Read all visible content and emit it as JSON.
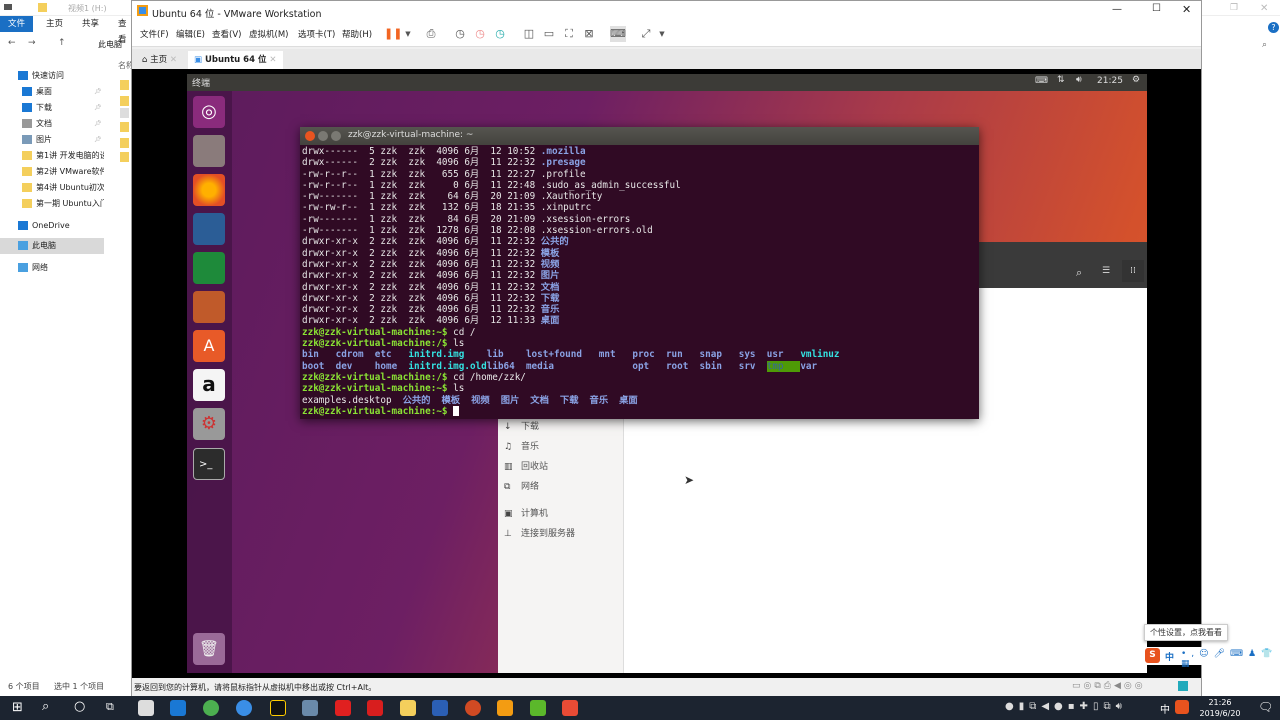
{
  "explorer": {
    "title": "视频1 (H:)",
    "ribbon_tabs": [
      "文件",
      "主页",
      "共享",
      "查看"
    ],
    "breadcrumb": "此电脑",
    "column_header": "名称",
    "sidebar": [
      {
        "label": "快速访问",
        "icon": "star-icon"
      },
      {
        "label": "桌面",
        "icon": "desktop-icon",
        "pinned": true
      },
      {
        "label": "下载",
        "icon": "download-icon",
        "pinned": true
      },
      {
        "label": "文档",
        "icon": "document-icon",
        "pinned": true
      },
      {
        "label": "图片",
        "icon": "picture-icon",
        "pinned": true
      },
      {
        "label": "第1讲 开发电脑的设",
        "icon": "folder-icon"
      },
      {
        "label": "第2讲 VMware软件",
        "icon": "folder-icon"
      },
      {
        "label": "第4讲 Ubuntu初次",
        "icon": "folder-icon"
      },
      {
        "label": "第一期 Ubuntu入门",
        "icon": "folder-icon"
      },
      {
        "label": "OneDrive",
        "icon": "cloud-icon"
      },
      {
        "label": "此电脑",
        "icon": "computer-icon",
        "selected": true
      },
      {
        "label": "网络",
        "icon": "network-icon"
      }
    ],
    "status_items": "6 个项目",
    "status_selected": "选中 1 个项目"
  },
  "vmware": {
    "title": "Ubuntu 64 位 - VMware Workstation",
    "menu": [
      "文件(F)",
      "编辑(E)",
      "查看(V)",
      "虚拟机(M)",
      "选项卡(T)",
      "帮助(H)"
    ],
    "tabs": [
      {
        "label": "主页",
        "active": false
      },
      {
        "label": "Ubuntu 64 位",
        "active": true
      }
    ],
    "status_text": "要返回到您的计算机，请将鼠标指针从虚拟机中移出或按 Ctrl+Alt。"
  },
  "ubuntu": {
    "top_title": "终端",
    "clock": "21:25",
    "launcher": [
      "ubuntu-dash-icon",
      "files-icon",
      "firefox-icon",
      "writer-icon",
      "calc-icon",
      "impress-icon",
      "software-center-icon",
      "amazon-icon",
      "settings-icon",
      "terminal-icon"
    ],
    "trash": "trash-icon",
    "nautilus_sidebar": [
      "下载",
      "音乐",
      "回收站",
      "网络",
      "计算机",
      "连接到服务器"
    ],
    "terminal": {
      "title": "zzk@zzk-virtual-machine: ~",
      "listing": [
        [
          "drwx------",
          "5",
          "zzk",
          "zzk",
          "4096",
          "6月",
          "12",
          "10:52",
          ".mozilla",
          "blue"
        ],
        [
          "drwx------",
          "2",
          "zzk",
          "zzk",
          "4096",
          "6月",
          "11",
          "22:32",
          ".presage",
          "blue"
        ],
        [
          "-rw-r--r--",
          "1",
          "zzk",
          "zzk",
          "655",
          "6月",
          "11",
          "22:27",
          ".profile",
          ""
        ],
        [
          "-rw-r--r--",
          "1",
          "zzk",
          "zzk",
          "0",
          "6月",
          "11",
          "22:48",
          ".sudo_as_admin_successful",
          ""
        ],
        [
          "-rw-------",
          "1",
          "zzk",
          "zzk",
          "64",
          "6月",
          "20",
          "21:09",
          ".Xauthority",
          ""
        ],
        [
          "-rw-rw-r--",
          "1",
          "zzk",
          "zzk",
          "132",
          "6月",
          "18",
          "21:35",
          ".xinputrc",
          ""
        ],
        [
          "-rw-------",
          "1",
          "zzk",
          "zzk",
          "84",
          "6月",
          "20",
          "21:09",
          ".xsession-errors",
          ""
        ],
        [
          "-rw-------",
          "1",
          "zzk",
          "zzk",
          "1278",
          "6月",
          "18",
          "22:08",
          ".xsession-errors.old",
          ""
        ],
        [
          "drwxr-xr-x",
          "2",
          "zzk",
          "zzk",
          "4096",
          "6月",
          "11",
          "22:32",
          "公共的",
          "blue"
        ],
        [
          "drwxr-xr-x",
          "2",
          "zzk",
          "zzk",
          "4096",
          "6月",
          "11",
          "22:32",
          "模板",
          "blue"
        ],
        [
          "drwxr-xr-x",
          "2",
          "zzk",
          "zzk",
          "4096",
          "6月",
          "11",
          "22:32",
          "视频",
          "blue"
        ],
        [
          "drwxr-xr-x",
          "2",
          "zzk",
          "zzk",
          "4096",
          "6月",
          "11",
          "22:32",
          "图片",
          "blue"
        ],
        [
          "drwxr-xr-x",
          "2",
          "zzk",
          "zzk",
          "4096",
          "6月",
          "11",
          "22:32",
          "文档",
          "blue"
        ],
        [
          "drwxr-xr-x",
          "2",
          "zzk",
          "zzk",
          "4096",
          "6月",
          "11",
          "22:32",
          "下载",
          "blue"
        ],
        [
          "drwxr-xr-x",
          "2",
          "zzk",
          "zzk",
          "4096",
          "6月",
          "11",
          "22:32",
          "音乐",
          "blue"
        ],
        [
          "drwxr-xr-x",
          "2",
          "zzk",
          "zzk",
          "4096",
          "6月",
          "12",
          "11:33",
          "桌面",
          "blue"
        ]
      ],
      "prompt_home": "zzk@zzk-virtual-machine:~$",
      "prompt_root": "zzk@zzk-virtual-machine:/$",
      "cmd1": " cd /",
      "cmd2": " ls",
      "root_ls_row1": [
        [
          "bin",
          "blue"
        ],
        [
          "cdrom",
          "blue"
        ],
        [
          "etc",
          "blue"
        ],
        [
          "initrd.img",
          "cyan"
        ],
        [
          "lib",
          "blue"
        ],
        [
          "lost+found",
          "blue"
        ],
        [
          "mnt",
          "blue"
        ],
        [
          "proc",
          "blue"
        ],
        [
          "run",
          "blue"
        ],
        [
          "snap",
          "blue"
        ],
        [
          "sys",
          "blue"
        ],
        [
          "usr",
          "blue"
        ],
        [
          "vmlinuz",
          "cyan"
        ]
      ],
      "root_ls_row2": [
        [
          "boot",
          "blue"
        ],
        [
          "dev",
          "blue"
        ],
        [
          "home",
          "blue"
        ],
        [
          "initrd.img.old",
          "cyan"
        ],
        [
          "lib64",
          "blue"
        ],
        [
          "media",
          "blue"
        ],
        [
          "",
          "blue"
        ],
        [
          "opt",
          "blue"
        ],
        [
          "root",
          "blue"
        ],
        [
          "sbin",
          "blue"
        ],
        [
          "srv",
          "blue"
        ],
        [
          "tmp",
          "hl"
        ],
        [
          "var",
          "blue"
        ]
      ],
      "cmd3": " cd /home/zzk/",
      "cmd4": " ls",
      "home_ls": [
        "examples.desktop",
        "公共的",
        "模板",
        "视频",
        "图片",
        "文档",
        "下载",
        "音乐",
        "桌面"
      ]
    }
  },
  "taskbar": {
    "time": "21:26",
    "date": "2019/6/20",
    "ime_label": "中",
    "tooltip": "个性设置，点我看看"
  }
}
